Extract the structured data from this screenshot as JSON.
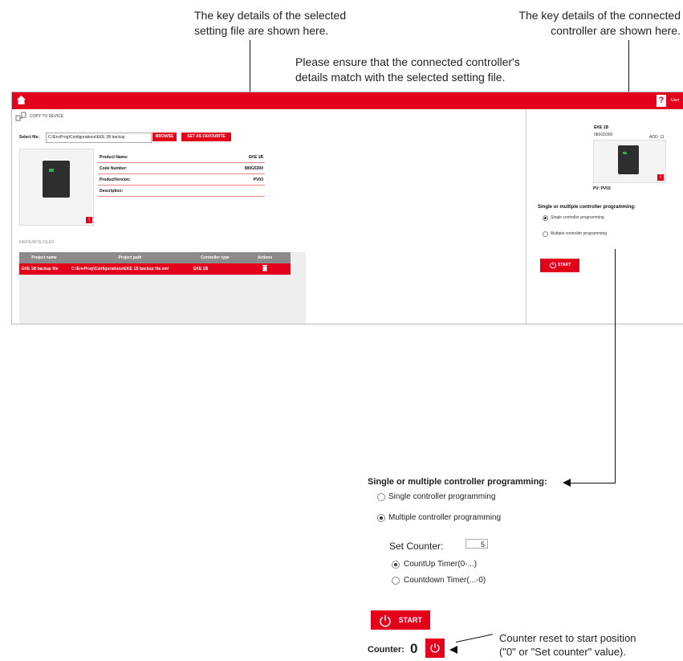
{
  "callouts": {
    "setting_file_line1": "The key details of the selected",
    "setting_file_line2": "setting file are shown here.",
    "controller_line1": "The key details of the connected",
    "controller_line2": "controller are shown here.",
    "match_line1": "Please ensure that the connected controller's",
    "match_line2": "details match with the selected setting file.",
    "counter_reset_line1": "Counter reset to start position",
    "counter_reset_line2": "(\"0\" or \"Set counter\" value)."
  },
  "app": {
    "accent_color": "#e2001a",
    "home_icon": "home-icon",
    "help_label": "?",
    "user_label": "User",
    "breadcrumb": "COPY TO DEVICE",
    "select_file_label": "Select file:",
    "select_file_value": "C:\\EnvProg\\Configurations\\EKE 1B backup",
    "browse_label": "BROWSE",
    "set_favourite_label": "SET AS FAVOURITE",
    "product_info": [
      {
        "label": "Product Name:",
        "value": "EKE 1B"
      },
      {
        "label": "Code Number:",
        "value": "080G5300"
      },
      {
        "label": "ProductVersion:",
        "value": "PV03"
      },
      {
        "label": "Description:",
        "value": ""
      }
    ],
    "favourite_files_label": "FAVOURITE FILES",
    "fav_table": {
      "headers": [
        "Project name",
        "Project path",
        "Controller type",
        "Actions"
      ],
      "rows": [
        {
          "name": "EKE 1B backup file",
          "path": "C:\\EnvProg\\Configurations\\EKE 1B backup file.xml",
          "type": "EKE 1B",
          "action_icon": "trash-icon"
        }
      ]
    },
    "controller": {
      "name": "EKE 1B",
      "code": "080G5300",
      "address": "ADD: 11",
      "pv": "PV: PV03"
    },
    "programming_title": "Single or multiple controller programming:",
    "options": [
      "Single controller programming",
      "Multiple controller programming"
    ],
    "selected_option": "Single controller programming",
    "start_label": "START"
  },
  "lower_panel": {
    "title": "Single or multiple controller programming:",
    "option_single": "Single controller programming",
    "option_multiple": "Multiple controller programming",
    "selected": "Multiple controller programming",
    "set_counter_label": "Set Counter:",
    "set_counter_value": "5",
    "countup_label": "CountUp Timer(0-...)",
    "countdown_label": "Countdown Timer(...-0)",
    "timer_selected": "CountUp Timer(0-...)",
    "start_label": "START",
    "counter_label": "Counter:",
    "counter_value": "0"
  }
}
